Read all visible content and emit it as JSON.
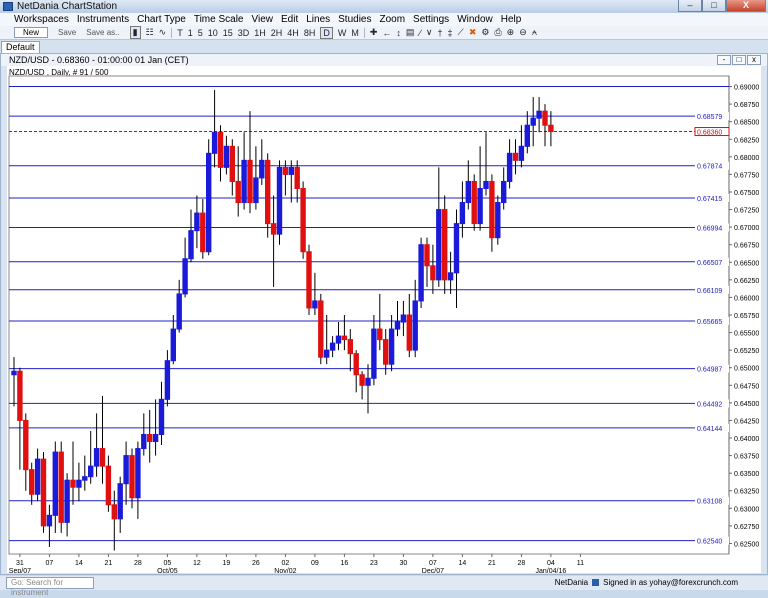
{
  "window": {
    "title": "NetDania ChartStation",
    "controls": [
      "–",
      "□",
      "X"
    ]
  },
  "menu": [
    "Workspaces",
    "Instruments",
    "Chart Type",
    "Time Scale",
    "View",
    "Edit",
    "Lines",
    "Studies",
    "Zoom",
    "Settings",
    "Window",
    "Help"
  ],
  "toolbar": {
    "new_label": "New",
    "save_label": "Save",
    "save_as_label": "Save as..",
    "timescales": [
      "T",
      "1",
      "5",
      "10",
      "15",
      "3D",
      "1H",
      "2H",
      "4H",
      "8H",
      "D",
      "W",
      "M"
    ],
    "active_timescale": "D"
  },
  "tab": {
    "label": "Default"
  },
  "chart_window": {
    "title": "NZD/USD - 0.68360 - 01:00:00  01 Jan (CET)"
  },
  "statusbar": {
    "search_placeholder": "Go: Search for instrument",
    "brand": "NetDania",
    "signed_in": "Signed in as yohay@forexcrunch.com"
  },
  "chart_data": {
    "type": "candlestick",
    "title": "NZD/USD , Daily, # 91 / 500",
    "ylim": [
      0.6235,
      0.6915
    ],
    "y_ticks": [
      0.625,
      0.6275,
      0.63,
      0.6325,
      0.635,
      0.6375,
      0.64,
      0.6425,
      0.645,
      0.6475,
      0.65,
      0.6525,
      0.655,
      0.6575,
      0.66,
      0.6625,
      0.665,
      0.6675,
      0.67,
      0.6725,
      0.675,
      0.6775,
      0.68,
      0.6825,
      0.685,
      0.6875,
      0.69
    ],
    "y_tick_labels": [
      "0.62500",
      "0.62750",
      "0.63000",
      "0.63250",
      "0.63500",
      "0.63750",
      "0.64000",
      "0.64250",
      "0.64500",
      "0.64750",
      "0.65000",
      "0.65250",
      "0.65500",
      "0.65750",
      "0.66000",
      "0.66250",
      "0.66500",
      "0.66750",
      "0.67000",
      "0.67250",
      "0.67500",
      "0.67750",
      "0.68000",
      "0.68250",
      "0.68500",
      "0.68750",
      "0.69000"
    ],
    "current_price": 0.6836,
    "current_price_label": "0.68360",
    "horizontal_lines": [
      {
        "value": 0.68579,
        "label": "0.68579"
      },
      {
        "value": 0.67874,
        "label": "0.67874"
      },
      {
        "value": 0.67415,
        "label": "0.67415"
      },
      {
        "value": 0.66994,
        "label": "0.66994"
      },
      {
        "value": 0.66507,
        "label": "0.66507"
      },
      {
        "value": 0.66109,
        "label": "0.66109"
      },
      {
        "value": 0.65665,
        "label": "0.65665"
      },
      {
        "value": 0.64987,
        "label": "0.64987"
      },
      {
        "value": 0.64492,
        "label": "0.64492"
      },
      {
        "value": 0.64144,
        "label": "0.64144"
      },
      {
        "value": 0.63108,
        "label": "0.63108"
      },
      {
        "value": 0.6254,
        "label": "0.62540"
      },
      {
        "value": 0.69,
        "label": ""
      }
    ],
    "x_labels": [
      {
        "index": 1,
        "day": "31",
        "month": "Sep/07"
      },
      {
        "index": 6,
        "day": "07",
        "month": ""
      },
      {
        "index": 11,
        "day": "14",
        "month": ""
      },
      {
        "index": 16,
        "day": "21",
        "month": ""
      },
      {
        "index": 21,
        "day": "28",
        "month": ""
      },
      {
        "index": 26,
        "day": "05",
        "month": "Oct/05"
      },
      {
        "index": 31,
        "day": "12",
        "month": ""
      },
      {
        "index": 36,
        "day": "19",
        "month": ""
      },
      {
        "index": 41,
        "day": "26",
        "month": ""
      },
      {
        "index": 46,
        "day": "02",
        "month": "Nov/02"
      },
      {
        "index": 51,
        "day": "09",
        "month": ""
      },
      {
        "index": 56,
        "day": "16",
        "month": ""
      },
      {
        "index": 61,
        "day": "23",
        "month": ""
      },
      {
        "index": 66,
        "day": "30",
        "month": ""
      },
      {
        "index": 71,
        "day": "07",
        "month": "Dec/07"
      },
      {
        "index": 76,
        "day": "14",
        "month": ""
      },
      {
        "index": 81,
        "day": "21",
        "month": ""
      },
      {
        "index": 86,
        "day": "28",
        "month": ""
      },
      {
        "index": 91,
        "day": "04",
        "month": "Jan/04/16"
      },
      {
        "index": 96,
        "day": "11",
        "month": ""
      }
    ],
    "candles": [
      [
        0.649,
        0.6495,
        0.6515,
        0.6445
      ],
      [
        0.6495,
        0.6425,
        0.65,
        0.6355
      ],
      [
        0.6425,
        0.6355,
        0.6435,
        0.6325
      ],
      [
        0.6355,
        0.632,
        0.6365,
        0.6305
      ],
      [
        0.632,
        0.637,
        0.6385,
        0.631
      ],
      [
        0.637,
        0.6275,
        0.638,
        0.6265
      ],
      [
        0.6275,
        0.629,
        0.6305,
        0.6245
      ],
      [
        0.629,
        0.638,
        0.6395,
        0.6265
      ],
      [
        0.638,
        0.628,
        0.6395,
        0.6265
      ],
      [
        0.628,
        0.634,
        0.635,
        0.626
      ],
      [
        0.634,
        0.633,
        0.6395,
        0.6305
      ],
      [
        0.633,
        0.634,
        0.6365,
        0.631
      ],
      [
        0.634,
        0.6345,
        0.6375,
        0.6325
      ],
      [
        0.6345,
        0.636,
        0.641,
        0.6335
      ],
      [
        0.636,
        0.6385,
        0.6435,
        0.6345
      ],
      [
        0.6385,
        0.636,
        0.646,
        0.6335
      ],
      [
        0.636,
        0.6305,
        0.6375,
        0.6295
      ],
      [
        0.6305,
        0.6285,
        0.6325,
        0.624
      ],
      [
        0.6285,
        0.6335,
        0.6345,
        0.6265
      ],
      [
        0.6335,
        0.6375,
        0.6395,
        0.6305
      ],
      [
        0.6375,
        0.6315,
        0.6385,
        0.63
      ],
      [
        0.6315,
        0.6385,
        0.6395,
        0.6285
      ],
      [
        0.6385,
        0.6405,
        0.6435,
        0.6375
      ],
      [
        0.6405,
        0.6395,
        0.644,
        0.6365
      ],
      [
        0.6395,
        0.6405,
        0.6455,
        0.6375
      ],
      [
        0.6405,
        0.6455,
        0.648,
        0.639
      ],
      [
        0.6455,
        0.651,
        0.6525,
        0.6445
      ],
      [
        0.651,
        0.6555,
        0.6575,
        0.6505
      ],
      [
        0.6555,
        0.6605,
        0.6625,
        0.655
      ],
      [
        0.6605,
        0.6655,
        0.6685,
        0.66
      ],
      [
        0.6655,
        0.6695,
        0.6725,
        0.665
      ],
      [
        0.6695,
        0.672,
        0.6745,
        0.667
      ],
      [
        0.672,
        0.6665,
        0.674,
        0.6655
      ],
      [
        0.6665,
        0.6805,
        0.6825,
        0.666
      ],
      [
        0.6805,
        0.6835,
        0.6895,
        0.6785
      ],
      [
        0.6835,
        0.6785,
        0.6845,
        0.6765
      ],
      [
        0.6785,
        0.6815,
        0.683,
        0.6775
      ],
      [
        0.6815,
        0.6765,
        0.6825,
        0.6745
      ],
      [
        0.6765,
        0.6735,
        0.6815,
        0.6715
      ],
      [
        0.6735,
        0.6795,
        0.6835,
        0.6725
      ],
      [
        0.6795,
        0.6735,
        0.6865,
        0.672
      ],
      [
        0.6735,
        0.677,
        0.6815,
        0.6725
      ],
      [
        0.677,
        0.6795,
        0.6825,
        0.676
      ],
      [
        0.6795,
        0.6705,
        0.6805,
        0.6685
      ],
      [
        0.6705,
        0.669,
        0.6745,
        0.6615
      ],
      [
        0.669,
        0.6785,
        0.6795,
        0.6675
      ],
      [
        0.6785,
        0.6775,
        0.6795,
        0.6745
      ],
      [
        0.6775,
        0.6785,
        0.6795,
        0.6735
      ],
      [
        0.6785,
        0.6755,
        0.6795,
        0.6735
      ],
      [
        0.6755,
        0.6665,
        0.6765,
        0.6655
      ],
      [
        0.6665,
        0.6585,
        0.6675,
        0.6575
      ],
      [
        0.6585,
        0.6595,
        0.6635,
        0.6575
      ],
      [
        0.6595,
        0.6515,
        0.6605,
        0.6505
      ],
      [
        0.6515,
        0.6525,
        0.6575,
        0.6505
      ],
      [
        0.6525,
        0.6535,
        0.6545,
        0.6515
      ],
      [
        0.6535,
        0.6545,
        0.6565,
        0.6525
      ],
      [
        0.6545,
        0.654,
        0.6575,
        0.6525
      ],
      [
        0.654,
        0.652,
        0.6555,
        0.6495
      ],
      [
        0.652,
        0.649,
        0.6525,
        0.6465
      ],
      [
        0.649,
        0.6475,
        0.6495,
        0.6455
      ],
      [
        0.6475,
        0.6485,
        0.6505,
        0.6435
      ],
      [
        0.6485,
        0.6555,
        0.6575,
        0.6475
      ],
      [
        0.6555,
        0.654,
        0.6605,
        0.6525
      ],
      [
        0.654,
        0.6505,
        0.6555,
        0.649
      ],
      [
        0.6505,
        0.6555,
        0.6575,
        0.6495
      ],
      [
        0.6555,
        0.6565,
        0.6595,
        0.6545
      ],
      [
        0.6565,
        0.6575,
        0.6595,
        0.6545
      ],
      [
        0.6575,
        0.6525,
        0.6605,
        0.6515
      ],
      [
        0.6525,
        0.6595,
        0.6625,
        0.6515
      ],
      [
        0.6595,
        0.6675,
        0.6685,
        0.6585
      ],
      [
        0.6675,
        0.6645,
        0.6685,
        0.6615
      ],
      [
        0.6645,
        0.6625,
        0.6675,
        0.6605
      ],
      [
        0.6625,
        0.6725,
        0.6785,
        0.6615
      ],
      [
        0.6725,
        0.6625,
        0.6745,
        0.6605
      ],
      [
        0.6625,
        0.6635,
        0.6665,
        0.6605
      ],
      [
        0.6635,
        0.6705,
        0.6725,
        0.6585
      ],
      [
        0.6705,
        0.6735,
        0.6765,
        0.6685
      ],
      [
        0.6735,
        0.6765,
        0.6795,
        0.6725
      ],
      [
        0.6765,
        0.6705,
        0.6775,
        0.6695
      ],
      [
        0.6705,
        0.6755,
        0.6815,
        0.6695
      ],
      [
        0.6755,
        0.6765,
        0.6835,
        0.6745
      ],
      [
        0.6765,
        0.6685,
        0.6775,
        0.6665
      ],
      [
        0.6685,
        0.6735,
        0.6745,
        0.6675
      ],
      [
        0.6735,
        0.6765,
        0.6785,
        0.6725
      ],
      [
        0.6765,
        0.6805,
        0.6825,
        0.6755
      ],
      [
        0.6805,
        0.6795,
        0.6825,
        0.6775
      ],
      [
        0.6795,
        0.6815,
        0.6845,
        0.6785
      ],
      [
        0.6815,
        0.6845,
        0.6865,
        0.6805
      ],
      [
        0.6845,
        0.6855,
        0.6885,
        0.6815
      ],
      [
        0.6855,
        0.6865,
        0.6885,
        0.6835
      ],
      [
        0.6865,
        0.6845,
        0.6875,
        0.6815
      ],
      [
        0.6845,
        0.6836,
        0.6865,
        0.6815
      ]
    ]
  }
}
